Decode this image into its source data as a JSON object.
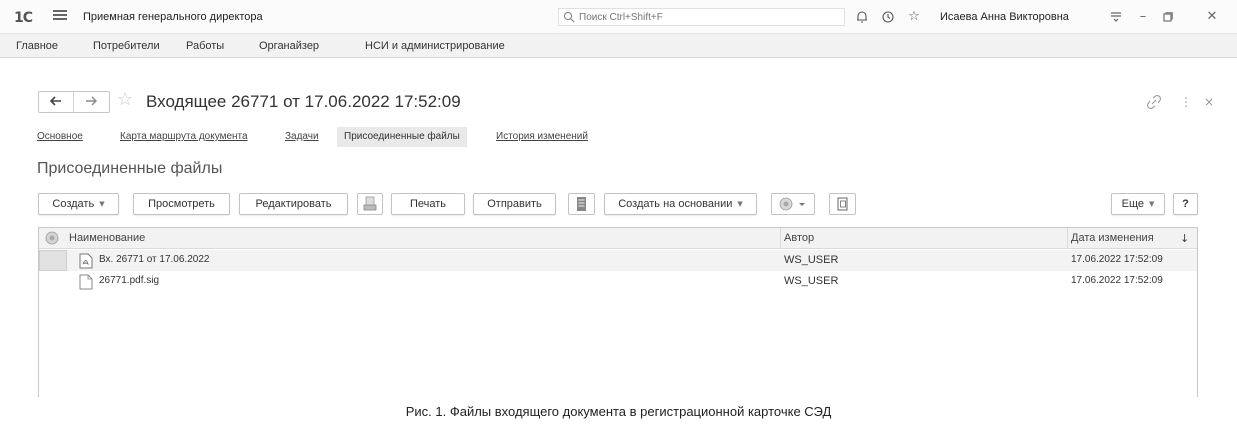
{
  "titlebar": {
    "logo": "1С",
    "app_title": "Приемная генерального директора",
    "search_placeholder": "Поиск Ctrl+Shift+F",
    "user_name": "Исаева Анна Викторовна"
  },
  "menu": {
    "items": [
      "Главное",
      "Потребители",
      "Работы",
      "Органайзер",
      "НСИ и администрирование"
    ]
  },
  "document": {
    "title": "Входящее 26771 от 17.06.2022 17:52:09"
  },
  "tabs": {
    "items": [
      "Основное",
      "Карта маршрута документа",
      "Задачи"
    ],
    "active": "Присоединенные файлы",
    "history": "История изменений"
  },
  "section": {
    "title": "Присоединенные файлы"
  },
  "toolbar": {
    "create": "Создать",
    "view": "Просмотреть",
    "edit": "Редактировать",
    "print": "Печать",
    "send": "Отправить",
    "create_based": "Создать на основании",
    "more": "Еще",
    "help": "?"
  },
  "table": {
    "columns": {
      "name": "Наименование",
      "author": "Автор",
      "modified": "Дата изменения"
    },
    "rows": [
      {
        "name": "Вх. 26771 от 17.06.2022",
        "author": "WS_USER",
        "modified": "17.06.2022 17:52:09",
        "icon": "pdf-file-icon"
      },
      {
        "name": "26771.pdf.sig",
        "author": "WS_USER",
        "modified": "17.06.2022 17:52:09",
        "icon": "file-icon"
      }
    ]
  },
  "caption": "Рис. 1. Файлы входящего документа в регистрационной карточке СЭД"
}
